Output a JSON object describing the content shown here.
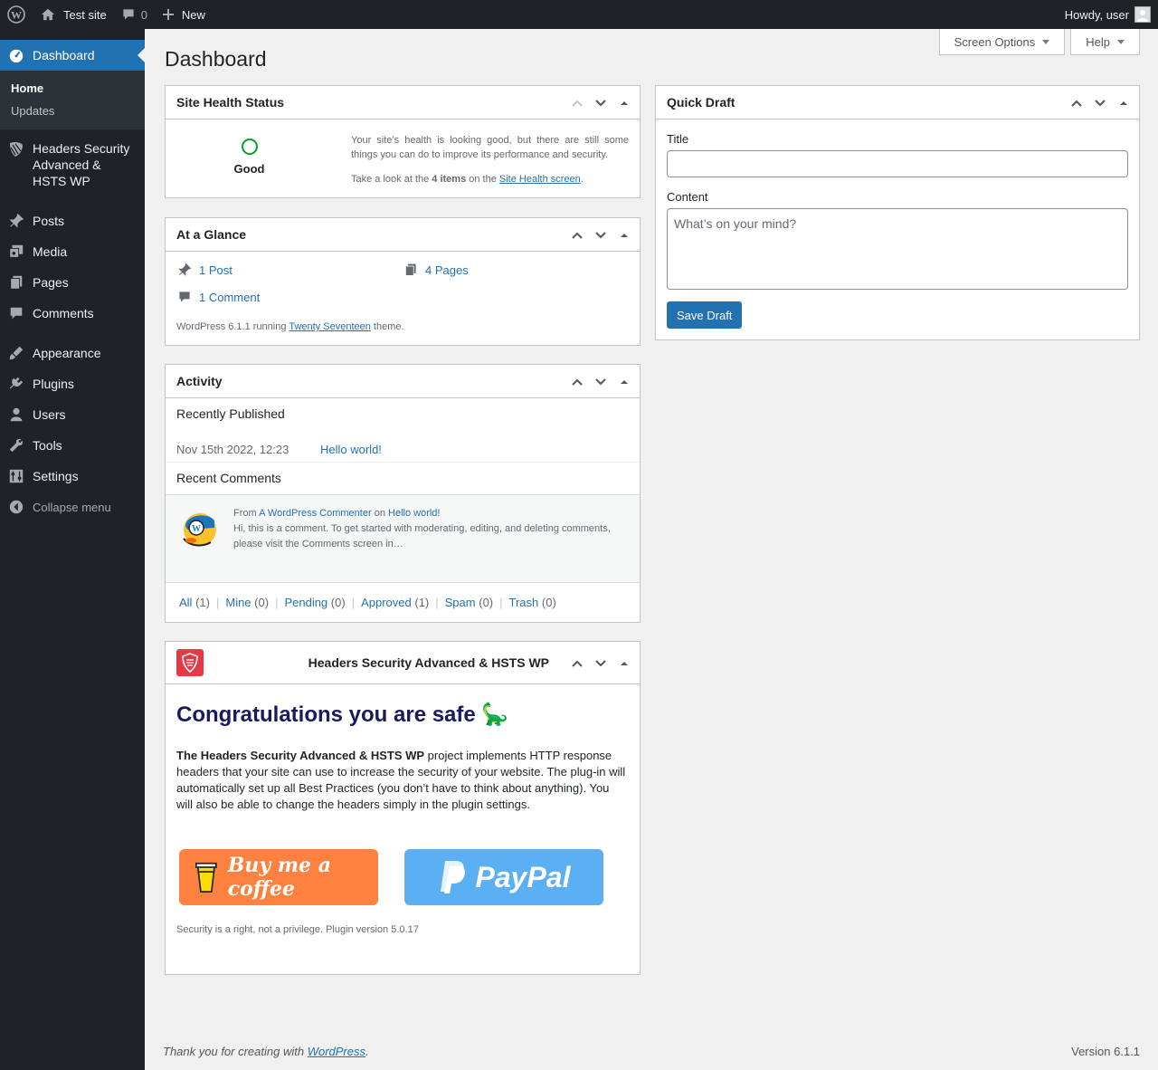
{
  "adminbar": {
    "site_name": "Test site",
    "comments_count": "0",
    "new_label": "New",
    "howdy": "Howdy, user"
  },
  "sidebar": {
    "dashboard": "Dashboard",
    "submenu": [
      "Home",
      "Updates"
    ],
    "headers_security": "Headers Security Advanced & HSTS WP",
    "items": [
      "Posts",
      "Media",
      "Pages",
      "Comments",
      "Appearance",
      "Plugins",
      "Users",
      "Tools",
      "Settings"
    ],
    "collapse": "Collapse menu"
  },
  "screen_options": "Screen Options",
  "help": "Help",
  "page_title": "Dashboard",
  "site_health": {
    "title": "Site Health Status",
    "status": "Good",
    "text1": "Your site’s health is looking good, but there are still some things you can do to improve its performance and security.",
    "text2_pre": "Take a look at the ",
    "text2_bold": "4 items",
    "text2_mid": " on the ",
    "text2_link": "Site Health screen",
    "text2_end": "."
  },
  "glance": {
    "title": "At a Glance",
    "posts": "1 Post",
    "pages": "4 Pages",
    "comments": "1 Comment",
    "foot_pre": "WordPress 6.1.1 running ",
    "foot_theme": "Twenty Seventeen",
    "foot_end": " theme."
  },
  "activity": {
    "title": "Activity",
    "recently_published": "Recently Published",
    "date": "Nov 15th 2022, 12:23",
    "post_link": "Hello world!",
    "recent_comments": "Recent Comments",
    "comment_from": "From",
    "commenter": "A WordPress Commenter",
    "comment_on": "on",
    "comment_post": "Hello world!",
    "comment_excerpt": "Hi, this is a comment. To get started with moderating, editing, and deleting comments, please visit the Comments screen in…",
    "filters": [
      {
        "label": "All",
        "count": "(1)"
      },
      {
        "label": "Mine",
        "count": "(0)"
      },
      {
        "label": "Pending",
        "count": "(0)"
      },
      {
        "label": "Approved",
        "count": "(1)"
      },
      {
        "label": "Spam",
        "count": "(0)"
      },
      {
        "label": "Trash",
        "count": "(0)"
      }
    ]
  },
  "headers_widget": {
    "title": "Headers Security Advanced & HSTS WP",
    "heading": "Congratulations you are safe 🦕",
    "para_bold": "The Headers Security Advanced & HSTS WP",
    "para_rest": " project implements HTTP response headers that your site can use to increase the security of your website. The plug-in will automatically set up all Best Practices (you don’t have to think about anything). You will also be able to change the headers simply in the plugin settings.",
    "bmc_label": "Buy me a coffee",
    "paypal_label": "PayPal",
    "footer": "Security is a right, not a privilege. Plugin version 5.0.17"
  },
  "quick_draft": {
    "title": "Quick Draft",
    "title_label": "Title",
    "title_value": "",
    "content_label": "Content",
    "content_placeholder": "What’s on your mind?",
    "save_label": "Save Draft"
  },
  "footer": {
    "thanks_pre": "Thank you for creating with ",
    "thanks_link": "WordPress",
    "thanks_end": ".",
    "version": "Version 6.1.1"
  },
  "colors": {
    "admin_bar": "#1d2327",
    "accent": "#2271b1",
    "health_good": "#00a32a",
    "coffee": "#ff813f",
    "paypal": "#5bb0f4"
  }
}
